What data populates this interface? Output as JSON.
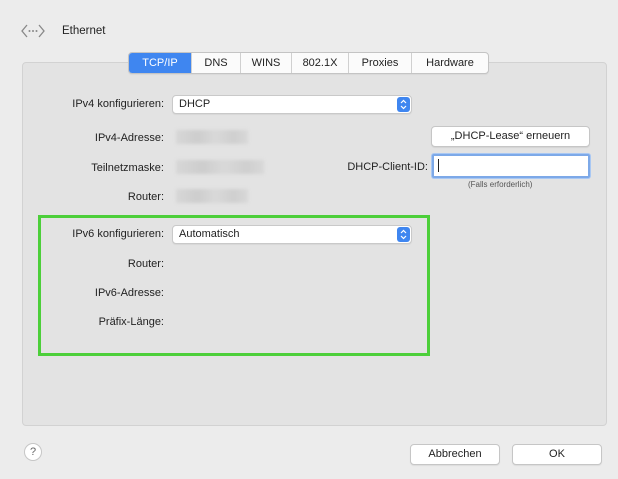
{
  "window": {
    "title": "Ethernet",
    "icon": "ethernet-icon"
  },
  "tabs": [
    {
      "label": "TCP/IP",
      "active": true
    },
    {
      "label": "DNS",
      "active": false
    },
    {
      "label": "WINS",
      "active": false
    },
    {
      "label": "802.1X",
      "active": false
    },
    {
      "label": "Proxies",
      "active": false
    },
    {
      "label": "Hardware",
      "active": false
    }
  ],
  "ipv4": {
    "configure_label": "IPv4 konfigurieren:",
    "configure_value": "DHCP",
    "address_label": "IPv4-Adresse:",
    "subnet_label": "Teilnetzmaske:",
    "router_label": "Router:"
  },
  "dhcp": {
    "renew_button": "„DHCP-Lease“ erneuern",
    "client_id_label": "DHCP-Client-ID:",
    "client_id_value": "",
    "client_id_hint": "(Falls erforderlich)"
  },
  "ipv6": {
    "configure_label": "IPv6 konfigurieren:",
    "configure_value": "Automatisch",
    "router_label": "Router:",
    "address_label": "IPv6-Adresse:",
    "prefix_label": "Präfix-Länge:"
  },
  "footer": {
    "help": "?",
    "cancel_button": "Abbrechen",
    "ok_button": "OK"
  },
  "colors": {
    "accent": "#3f86f0",
    "highlight": "#4ccf3a"
  }
}
